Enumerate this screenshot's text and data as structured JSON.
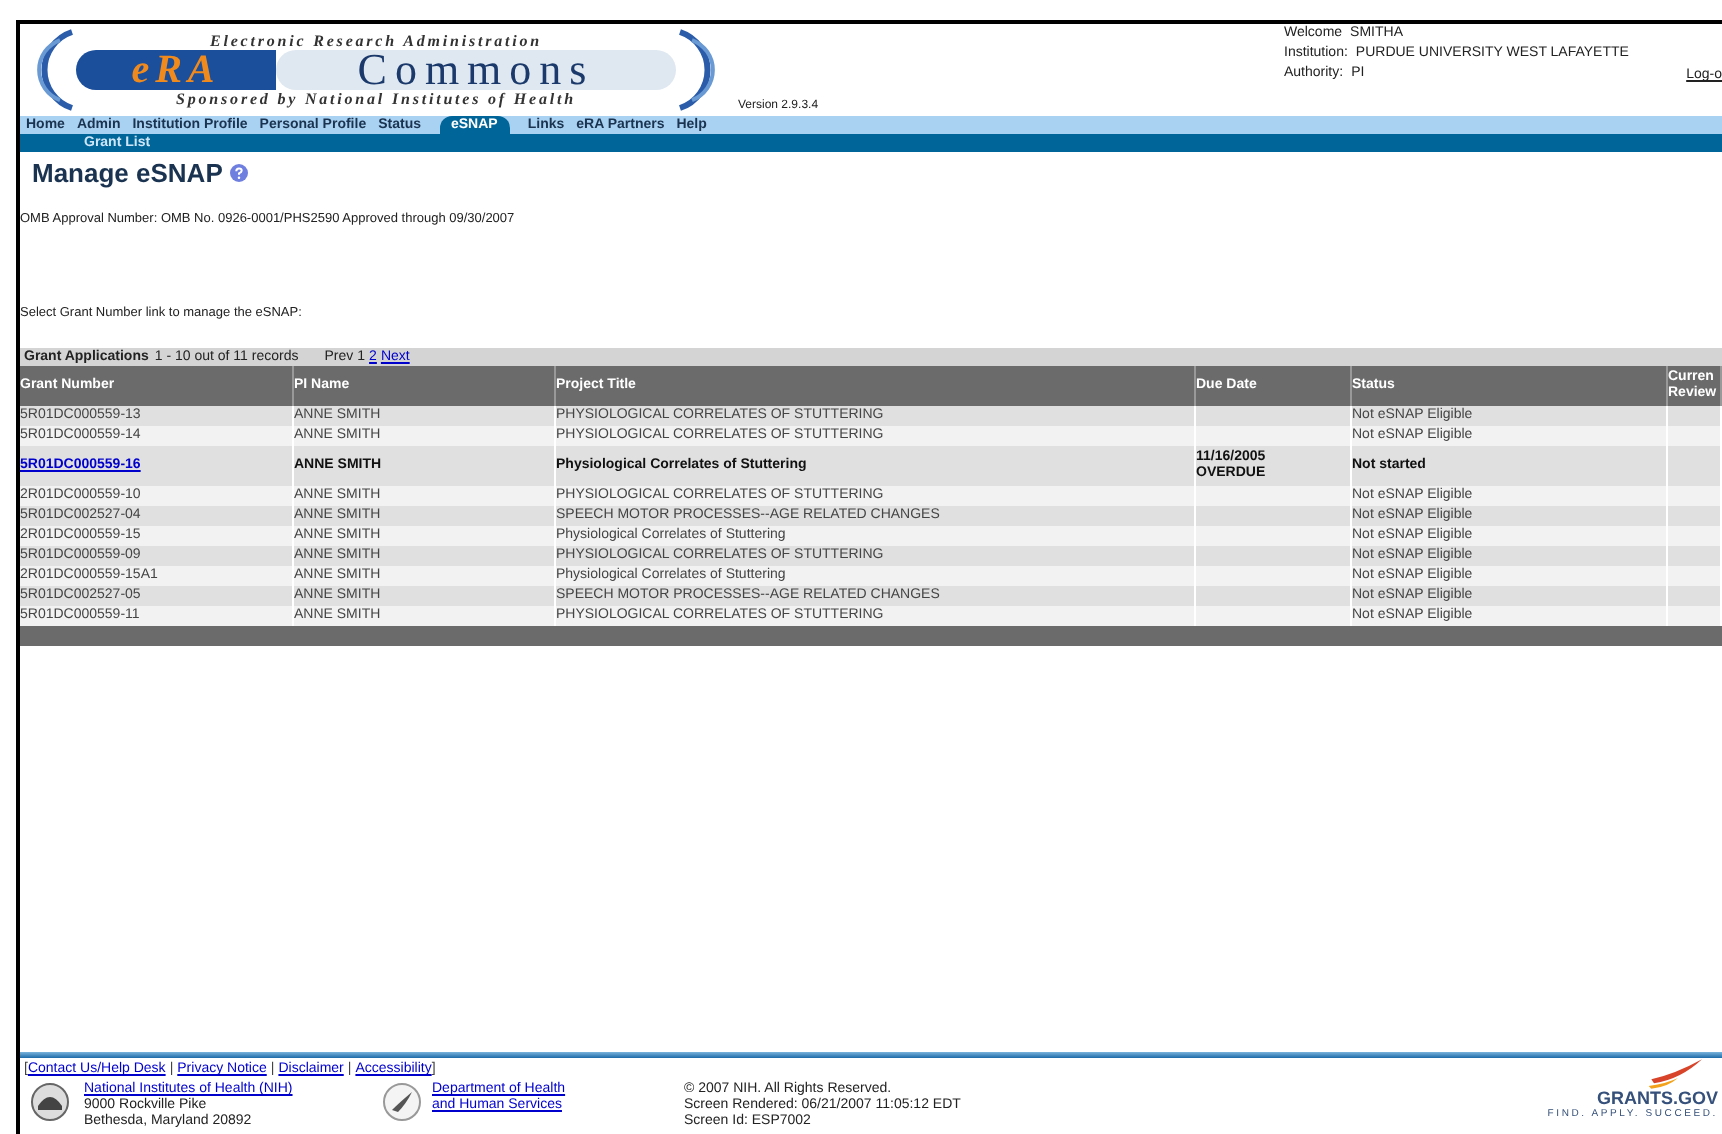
{
  "header": {
    "logo": {
      "top_line": "Electronic Research Administration",
      "mark": "eRA",
      "name": "Commons",
      "bottom_line": "Sponsored by National Institutes of Health"
    },
    "version": "Version 2.9.3.4",
    "user": [
      {
        "label": "Welcome",
        "value": "SMITHA"
      },
      {
        "label": "Institution:",
        "value": "PURDUE UNIVERSITY WEST LAFAYETTE"
      },
      {
        "label": "Authority:",
        "value": "PI"
      }
    ],
    "logout": "Log-o"
  },
  "nav": {
    "tabs": [
      {
        "label": "Home",
        "selected": false
      },
      {
        "label": "Admin",
        "selected": false
      },
      {
        "label": "Institution Profile",
        "selected": false
      },
      {
        "label": "Personal Profile",
        "selected": false
      },
      {
        "label": "Status",
        "selected": false
      },
      {
        "label": "eSNAP",
        "selected": true
      },
      {
        "label": "Links",
        "selected": false
      },
      {
        "label": "eRA Partners",
        "selected": false
      },
      {
        "label": "Help",
        "selected": false
      }
    ],
    "subtabs": [
      {
        "label": "Grant List",
        "selected": true
      }
    ]
  },
  "page": {
    "title": "Manage eSNAP",
    "omb": "OMB Approval Number: OMB No. 0926-0001/PHS2590 Approved through 09/30/2007",
    "instruction": "Select Grant Number link to manage the eSNAP:"
  },
  "table": {
    "caption": "Grant Applications",
    "count": "1 - 10 out of 11 records",
    "pager": [
      {
        "label": "Prev",
        "link": false
      },
      {
        "label": "1",
        "link": false
      },
      {
        "label": "2",
        "link": true
      },
      {
        "label": "Next",
        "link": true
      }
    ],
    "columns": [
      "Grant Number",
      "PI Name",
      "Project Title",
      "Due Date",
      "Status",
      "Curren Review"
    ],
    "rows": [
      {
        "kind": "plain",
        "grant": "5R01DC000559-13",
        "pi": "ANNE SMITH",
        "title": "PHYSIOLOGICAL CORRELATES OF STUTTERING",
        "due": [],
        "status": "Not eSNAP Eligible"
      },
      {
        "kind": "plain",
        "grant": "5R01DC000559-14",
        "pi": "ANNE SMITH",
        "title": "PHYSIOLOGICAL CORRELATES OF STUTTERING",
        "due": [],
        "status": "Not eSNAP Eligible"
      },
      {
        "kind": "actionable",
        "grant": "5R01DC000559-16",
        "pi": "ANNE SMITH",
        "title": "Physiological Correlates of Stuttering",
        "due": [
          "11/16/2005",
          "OVERDUE"
        ],
        "status": "Not started"
      },
      {
        "kind": "plain",
        "grant": "2R01DC000559-10",
        "pi": "ANNE SMITH",
        "title": "PHYSIOLOGICAL CORRELATES OF STUTTERING",
        "due": [],
        "status": "Not eSNAP Eligible"
      },
      {
        "kind": "plain",
        "grant": "5R01DC002527-04",
        "pi": "ANNE SMITH",
        "title": "SPEECH MOTOR PROCESSES--AGE RELATED CHANGES",
        "due": [],
        "status": "Not eSNAP Eligible"
      },
      {
        "kind": "plain",
        "grant": "2R01DC000559-15",
        "pi": "ANNE SMITH",
        "title": "Physiological Correlates of Stuttering",
        "due": [],
        "status": "Not eSNAP Eligible"
      },
      {
        "kind": "plain",
        "grant": "5R01DC000559-09",
        "pi": "ANNE SMITH",
        "title": "PHYSIOLOGICAL CORRELATES OF STUTTERING",
        "due": [],
        "status": "Not eSNAP Eligible"
      },
      {
        "kind": "plain",
        "grant": "2R01DC000559-15A1",
        "pi": "ANNE SMITH",
        "title": "Physiological Correlates of Stuttering",
        "due": [],
        "status": "Not eSNAP Eligible"
      },
      {
        "kind": "plain",
        "grant": "5R01DC002527-05",
        "pi": "ANNE SMITH",
        "title": "SPEECH MOTOR PROCESSES--AGE RELATED CHANGES",
        "due": [],
        "status": "Not eSNAP Eligible"
      },
      {
        "kind": "plain",
        "grant": "5R01DC000559-11",
        "pi": "ANNE SMITH",
        "title": "PHYSIOLOGICAL CORRELATES OF STUTTERING",
        "due": [],
        "status": "Not eSNAP Eligible"
      }
    ]
  },
  "footer": {
    "open": "[",
    "separator": "|",
    "close": "]",
    "links": [
      "Contact Us/Help Desk",
      "Privacy Notice",
      "Disclaimer",
      "Accessibility"
    ],
    "nih": {
      "link": "National Institutes of Health (NIH)",
      "lines": [
        "9000 Rockville Pike",
        "Bethesda, Maryland 20892"
      ]
    },
    "hhs": {
      "link": "Department of Health and Human Services"
    },
    "info": [
      "© 2007 NIH. All Rights Reserved.",
      "Screen Rendered: 06/21/2007 11:05:12 EDT",
      "Screen Id: ESP7002"
    ],
    "grants": {
      "name": "GRANTS.GOV",
      "tagline": "FIND. APPLY. SUCCEED."
    }
  }
}
